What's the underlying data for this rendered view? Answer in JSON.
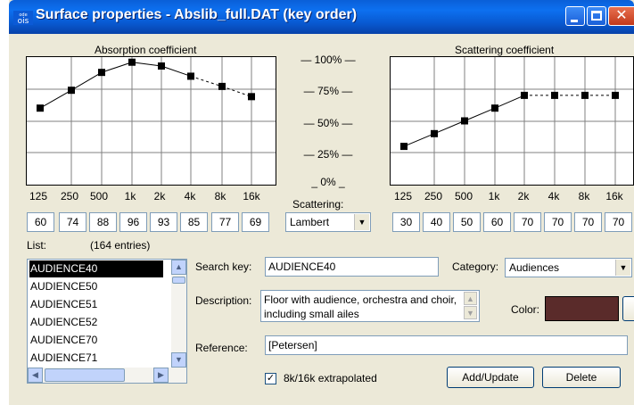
{
  "window": {
    "title": "Surface properties - Abslib_full.DAT (key order)",
    "app_icon_text": "ODEON"
  },
  "absorption": {
    "title": "Absorption coefficient",
    "frequencies": [
      "125",
      "250",
      "500",
      "1k",
      "2k",
      "4k",
      "8k",
      "16k"
    ],
    "values": [
      "60",
      "74",
      "88",
      "96",
      "93",
      "85",
      "77",
      "69"
    ]
  },
  "scattering": {
    "title": "Scattering coefficient",
    "frequencies": [
      "125",
      "250",
      "500",
      "1k",
      "2k",
      "4k",
      "8k",
      "16k"
    ],
    "values": [
      "30",
      "40",
      "50",
      "60",
      "70",
      "70",
      "70",
      "70"
    ]
  },
  "scale": {
    "labels": [
      "— 100% —",
      "— 75% —",
      "— 50% —",
      "— 25% —",
      "_ 0% _"
    ]
  },
  "scattering_method": {
    "label": "Scattering:",
    "value": "Lambert"
  },
  "list": {
    "label": "List:",
    "count": "(164 entries)",
    "items": [
      "AUDIENCE40",
      "AUDIENCE50",
      "AUDIENCE51",
      "AUDIENCE52",
      "AUDIENCE70",
      "AUDIENCE71"
    ],
    "selected": "AUDIENCE40"
  },
  "form": {
    "search_key_label": "Search key:",
    "search_key_value": "AUDIENCE40",
    "category_label": "Category:",
    "category_value": "Audiences",
    "description_label": "Description:",
    "description_value": "Floor with audience, orchestra and choir, including small ailes",
    "color_label": "Color:",
    "color_value": "#5a2b2a",
    "reference_label": "Reference:",
    "reference_value": "[Petersen]",
    "extrapolated_label": "8k/16k extrapolated",
    "extrapolated_checked": true
  },
  "buttons": {
    "add_update": "Add/Update",
    "delete": "Delete"
  },
  "chart_data": [
    {
      "type": "line",
      "title": "Absorption coefficient",
      "categories": [
        "125",
        "250",
        "500",
        "1k",
        "2k",
        "4k",
        "8k",
        "16k"
      ],
      "values": [
        60,
        74,
        88,
        96,
        93,
        85,
        77,
        69
      ],
      "ylim": [
        0,
        100
      ],
      "grid": true,
      "extrapolated_from": "8k"
    },
    {
      "type": "line",
      "title": "Scattering coefficient",
      "categories": [
        "125",
        "250",
        "500",
        "1k",
        "2k",
        "4k",
        "8k",
        "16k"
      ],
      "values": [
        30,
        40,
        50,
        60,
        70,
        70,
        70,
        70
      ],
      "ylim": [
        0,
        100
      ],
      "grid": true,
      "extrapolated_from": "4k"
    }
  ]
}
